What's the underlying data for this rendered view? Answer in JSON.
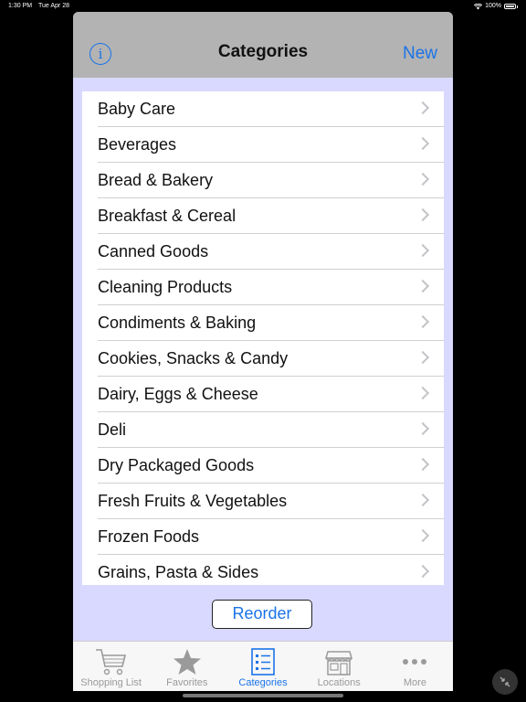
{
  "status_bar": {
    "time": "1:30 PM",
    "date": "Tue Apr 28",
    "battery": "100%"
  },
  "nav": {
    "title": "Categories",
    "new_label": "New",
    "info_glyph": "i"
  },
  "categories": [
    "Baby Care",
    "Beverages",
    "Bread & Bakery",
    "Breakfast & Cereal",
    "Canned Goods",
    "Cleaning Products",
    "Condiments & Baking",
    "Cookies, Snacks & Candy",
    "Dairy, Eggs & Cheese",
    "Deli",
    "Dry Packaged Goods",
    "Fresh Fruits & Vegetables",
    "Frozen Foods",
    "Grains, Pasta & Sides"
  ],
  "reorder_label": "Reorder",
  "tabs": [
    {
      "label": "Shopping List",
      "icon": "cart-icon",
      "active": false
    },
    {
      "label": "Favorites",
      "icon": "star-icon",
      "active": false
    },
    {
      "label": "Categories",
      "icon": "list-icon",
      "active": true
    },
    {
      "label": "Locations",
      "icon": "store-icon",
      "active": false
    },
    {
      "label": "More",
      "icon": "more-icon",
      "active": false
    }
  ],
  "colors": {
    "accent": "#1a73e8",
    "sheet_bg": "#d9d9ff",
    "nav_bg": "#b3b3b3"
  }
}
